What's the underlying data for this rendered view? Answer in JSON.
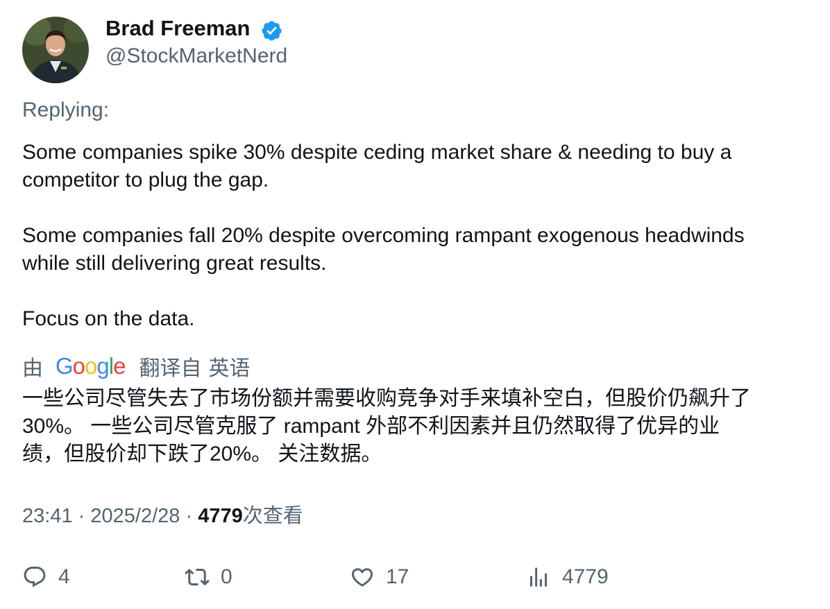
{
  "author": {
    "display_name": "Brad Freeman",
    "handle": "@StockMarketNerd",
    "verified_icon": "verified-badge-icon",
    "verified_color": "#1d9bf0"
  },
  "replying_label": "Replying:",
  "body": {
    "paragraphs": [
      [
        "Some companies spike 30% despite ceding market share & needing to buy a",
        "competitor to plug the gap."
      ],
      [
        "Some companies fall 20% despite overcoming rampant exogenous headwinds",
        "while still delivering great results."
      ],
      [
        "Focus on the data."
      ]
    ]
  },
  "translation": {
    "by_label": "由",
    "provider": "Google",
    "from_label": "翻译自",
    "language": "英语",
    "lines": [
      "一些公司尽管失去了市场份额并需要收购竞争对手来填补空白，但股价仍飙升了",
      "30%。 一些公司尽管克服了 rampant 外部不利因素并且仍然取得了优异的业",
      "绩，但股价却下跌了20%。 关注数据。"
    ]
  },
  "meta": {
    "time": "23:41",
    "separator": "·",
    "date": "2025/2/28",
    "views_count": "4779",
    "views_label": "次查看"
  },
  "actions": {
    "reply": {
      "icon": "reply-icon",
      "count": "4"
    },
    "retweet": {
      "icon": "retweet-icon",
      "count": "0"
    },
    "like": {
      "icon": "heart-icon",
      "count": "17"
    },
    "views": {
      "icon": "analytics-icon",
      "count": "4779"
    }
  },
  "colors": {
    "text_primary": "#0f1419",
    "text_secondary": "#536471",
    "accent": "#1d9bf0"
  }
}
